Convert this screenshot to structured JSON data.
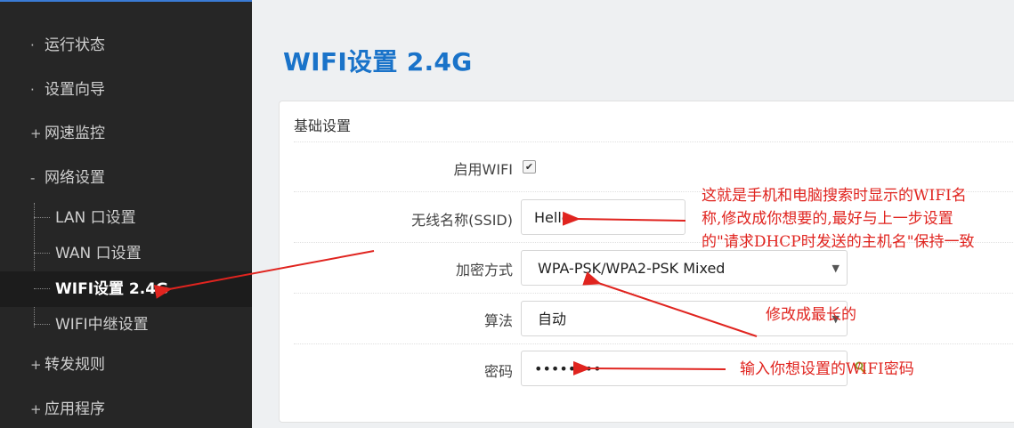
{
  "sidebar": {
    "items": [
      {
        "marker": "·",
        "label": "运行状态"
      },
      {
        "marker": "·",
        "label": "设置向导"
      },
      {
        "marker": "+",
        "label": "网速监控"
      },
      {
        "marker": "-",
        "label": "网络设置"
      }
    ],
    "subitems": [
      {
        "label": "LAN 口设置"
      },
      {
        "label": "WAN 口设置"
      },
      {
        "label": "WIFI设置 2.4G",
        "active": true
      },
      {
        "label": "WIFI中继设置"
      }
    ],
    "items_after": [
      {
        "marker": "+",
        "label": "转发规则"
      },
      {
        "marker": "+",
        "label": "应用程序"
      }
    ]
  },
  "page": {
    "title": "WIFI设置 2.4G"
  },
  "card": {
    "section_title": "基础设置",
    "fields": {
      "enable_wifi": {
        "label": "启用WIFI",
        "checked": true,
        "check_glyph": "✔"
      },
      "ssid": {
        "label": "无线名称(SSID)",
        "value": "Hello"
      },
      "encryption": {
        "label": "加密方式",
        "value": "WPA-PSK/WPA2-PSK Mixed",
        "caret": "▼"
      },
      "algorithm": {
        "label": "算法",
        "value": "自动",
        "caret": "▼"
      },
      "password": {
        "label": "密码",
        "value": "••••••••"
      }
    }
  },
  "annotations": {
    "ssid_note_lines": [
      "这就是手机和电脑搜索时显示的WIFI名",
      "称,修改成你想要的,最好与上一步设置",
      "的\"请求DHCP时发送的主机名\"保持一致"
    ],
    "encryption_note": "修改成最长的",
    "password_note": "输入你想设置的WIFI密码"
  },
  "colors": {
    "accent": "#1a73c9",
    "annotation": "#e0241f",
    "sidebar": "#262626"
  },
  "icons": {
    "password_key": "key-icon"
  }
}
